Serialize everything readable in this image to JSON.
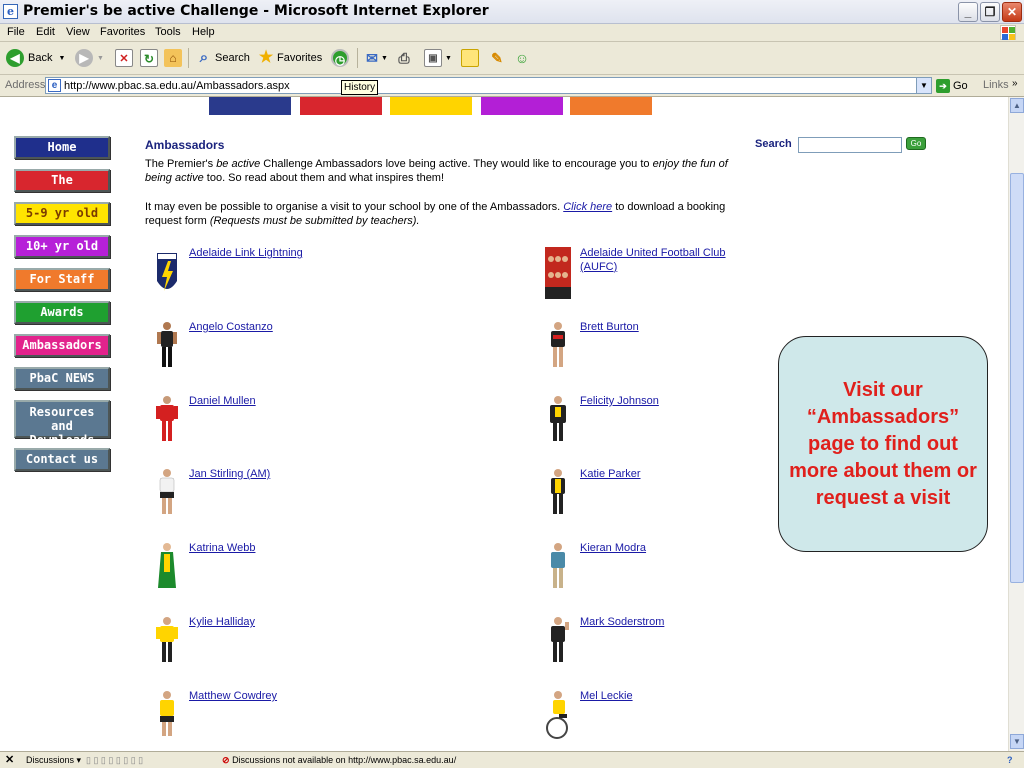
{
  "window": {
    "title": "Premier's be active Challenge - Microsoft Internet Explorer",
    "min_label": "_",
    "max_label": "❐",
    "close_label": "✕"
  },
  "menu": [
    "File",
    "Edit",
    "View",
    "Favorites",
    "Tools",
    "Help"
  ],
  "toolbar": {
    "back_label": "Back",
    "search_label": "Search",
    "favorites_label": "Favorites",
    "history_tooltip": "History"
  },
  "address": {
    "label": "Address",
    "url": "http://www.pbac.sa.edu.au/Ambassadors.aspx",
    "go_label": "Go",
    "links_label": "Links"
  },
  "colors": {
    "strip": [
      "#2a3a8c",
      "#d8262e",
      "#ffd400",
      "#b31fd6",
      "#f07a2c"
    ]
  },
  "nav": [
    {
      "label": "Home",
      "bg": "#1f2f8c",
      "text": "#ffffff"
    },
    {
      "label": "The Challenge",
      "bg": "#d8262e",
      "text": "#ffffff"
    },
    {
      "label": "5-9 yr old",
      "bg": "#ffe400",
      "text": "#7a3b00"
    },
    {
      "label": "10+ yr old",
      "bg": "#b620d8",
      "text": "#ffffff"
    },
    {
      "label": "For Staff",
      "bg": "#f07a2c",
      "text": "#ffffff"
    },
    {
      "label": "Awards",
      "bg": "#1fa030",
      "text": "#ffffff"
    },
    {
      "label": "Ambassadors",
      "bg": "#e2238c",
      "text": "#ffffff"
    },
    {
      "label": "PbaC NEWS",
      "bg": "#5b7891",
      "text": "#ffffff"
    },
    {
      "label": "Resources and Downloads",
      "bg": "#5b7891",
      "text": "#ffffff"
    },
    {
      "label": "Contact us",
      "bg": "#5b7891",
      "text": "#ffffff"
    }
  ],
  "page": {
    "heading": "Ambassadors",
    "intro_pre": "The Premier's ",
    "intro_em1": "be active",
    "intro_mid": " Challenge Ambassadors love being active. They would like to encourage you to ",
    "intro_em2": "enjoy the fun of being active",
    "intro_post": " too. So read about them and what inspires them!",
    "visit_pre": "It may even be possible to organise a visit to your school by one of the Ambassadors. ",
    "visit_link": "Click here",
    "visit_mid": "  to download a booking request form ",
    "visit_em": "(Requests must be submitted by teachers).",
    "search_label": "Search",
    "search_go": "Go"
  },
  "ambassadors_left": [
    "Adelaide Link Lightning",
    "Angelo Costanzo",
    "Daniel Mullen",
    "Jan Stirling (AM)",
    "Katrina Webb",
    "Kylie Halliday",
    "Matthew Cowdrey"
  ],
  "ambassadors_right": [
    "Adelaide United Football Club (AUFC)",
    "Brett Burton",
    "Felicity Johnson",
    "Katie Parker",
    "Kieran Modra",
    "Mark Soderstrom",
    "Mel Leckie"
  ],
  "callout": "Visit our “Ambassadors” page to find out more about them or request a visit",
  "discussions": {
    "label": "Discussions ▾",
    "status": "Discussions not available on http://www.pbac.sa.edu.au/"
  }
}
